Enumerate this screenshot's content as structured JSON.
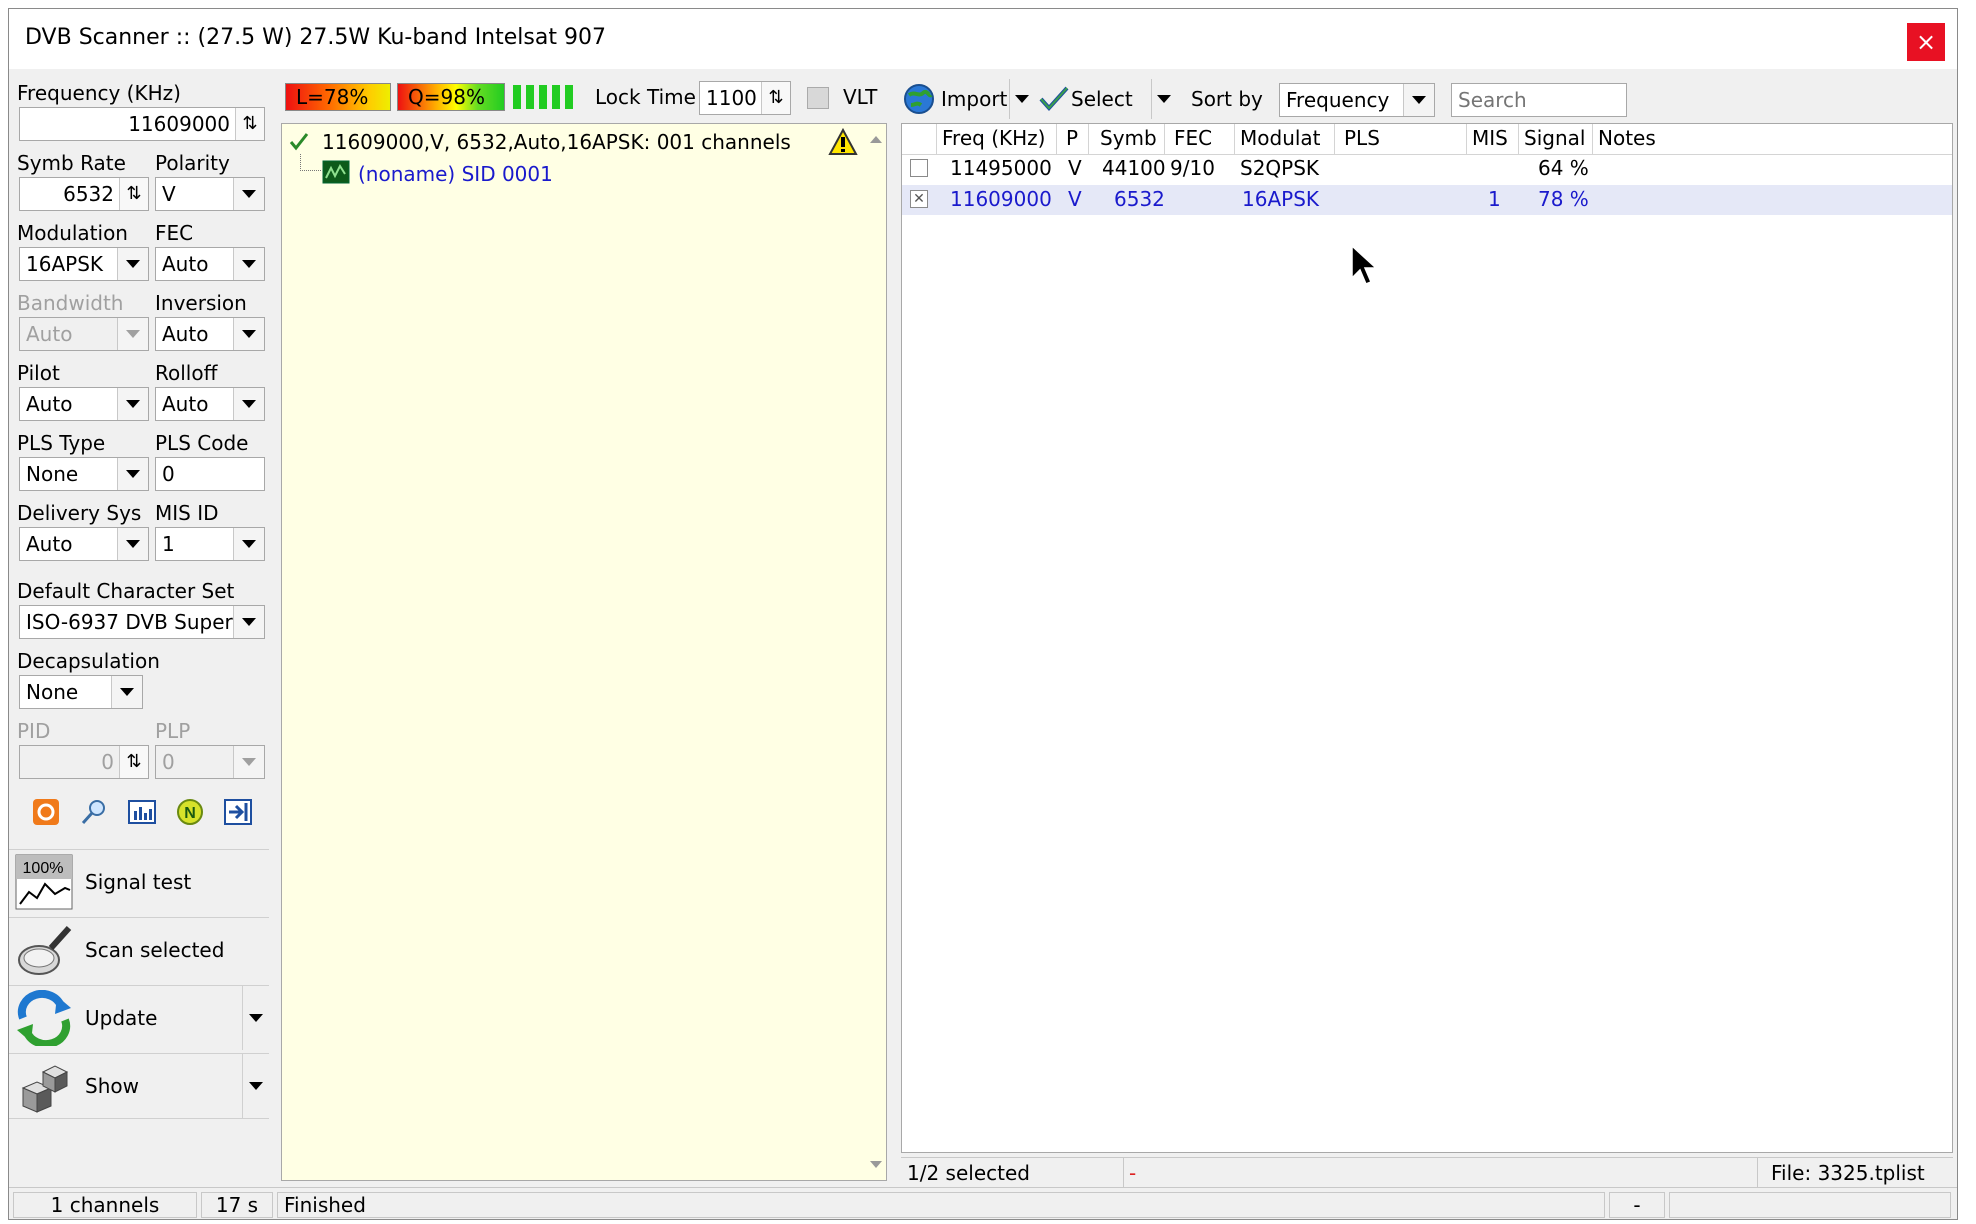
{
  "window": {
    "title": "DVB Scanner :: (27.5 W) 27.5W Ku-band Intelsat 907",
    "close": "×"
  },
  "left": {
    "frequency": {
      "label": "Frequency (KHz)",
      "value": "11609000"
    },
    "symb_rate": {
      "label": "Symb Rate",
      "value": "6532"
    },
    "polarity": {
      "label": "Polarity",
      "value": "V"
    },
    "modulation": {
      "label": "Modulation",
      "value": "16APSK"
    },
    "fec": {
      "label": "FEC",
      "value": "Auto"
    },
    "bandwidth": {
      "label": "Bandwidth",
      "value": "Auto"
    },
    "inversion": {
      "label": "Inversion",
      "value": "Auto"
    },
    "pilot": {
      "label": "Pilot",
      "value": "Auto"
    },
    "rolloff": {
      "label": "Rolloff",
      "value": "Auto"
    },
    "pls_type": {
      "label": "PLS Type",
      "value": "None"
    },
    "pls_code": {
      "label": "PLS Code",
      "value": "0"
    },
    "delivery_sys": {
      "label": "Delivery Sys",
      "value": "Auto"
    },
    "mis_id": {
      "label": "MIS ID",
      "value": "1"
    },
    "charset": {
      "label": "Default Character Set",
      "value": "ISO-6937 DVB Super"
    },
    "decapsulation": {
      "label": "Decapsulation",
      "value": "None"
    },
    "pid": {
      "label": "PID",
      "value": "0"
    },
    "plp": {
      "label": "PLP",
      "value": "0"
    },
    "buttons": {
      "signal_test": "Signal test",
      "scan_selected": "Scan selected",
      "update": "Update",
      "show": "Show"
    },
    "signal_icon_text": "100%"
  },
  "middle": {
    "level": "L=78%",
    "quality": "Q=98%",
    "lock_time_label": "Lock Time",
    "lock_time_value": "1100",
    "vlt_label": "VLT",
    "tree": {
      "transponder": "11609000,V, 6532,Auto,16APSK: 001 channels",
      "channel": "(noname) SID 0001"
    }
  },
  "right": {
    "import_label": "Import",
    "select_label": "Select",
    "sort_label": "Sort by",
    "sort_value": "Frequency",
    "search_placeholder": "Search",
    "columns": [
      "Freq (KHz)",
      "P",
      "Symb",
      "FEC",
      "Modulat",
      "PLS",
      "MIS",
      "Signal",
      "Notes"
    ],
    "rows": [
      {
        "freq": "11495000",
        "p": "V",
        "symb": "44100",
        "fec": "9/10",
        "mod": "S2QPSK",
        "pls": "",
        "mis": "",
        "signal": "64 %",
        "notes": "",
        "checked": false
      },
      {
        "freq": "11609000",
        "p": "V",
        "symb": "6532",
        "fec": "",
        "mod": "16APSK",
        "pls": "",
        "mis": "1",
        "signal": "78 %",
        "notes": "",
        "checked": true
      }
    ],
    "status_selected": "1/2 selected",
    "status_mid": "-",
    "status_file": "File: 3325.tplist"
  },
  "statusbar": {
    "channels": "1 channels",
    "time": "17 s",
    "state": "Finished",
    "dash": "-"
  },
  "colors": {
    "close": "#e81123",
    "tree_bg": "#ffffe4",
    "selected_row": "#e5e8f7",
    "link_blue": "#1a1acc"
  }
}
